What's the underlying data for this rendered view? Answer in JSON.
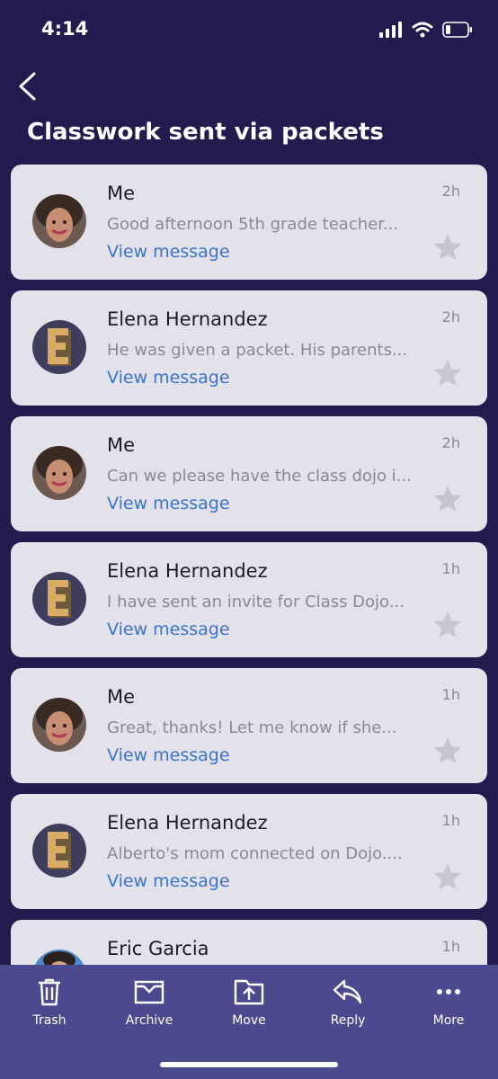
{
  "status": {
    "time": "4:14"
  },
  "header": {
    "title": "Classwork sent via packets"
  },
  "messages": [
    {
      "sender": "Me",
      "preview": "Good afternoon 5th grade teacher...",
      "link": "View message",
      "time": "2h",
      "avatar": "teacher-photo"
    },
    {
      "sender": "Elena Hernandez",
      "preview": "He was given a packet. His parents...",
      "link": "View message",
      "time": "2h",
      "avatar": "letter-e"
    },
    {
      "sender": "Me",
      "preview": "Can we please have the class dojo i...",
      "link": "View message",
      "time": "2h",
      "avatar": "teacher-photo"
    },
    {
      "sender": "Elena Hernandez",
      "preview": "I have sent an invite for Class Dojo...",
      "link": "View message",
      "time": "1h",
      "avatar": "letter-e"
    },
    {
      "sender": "Me",
      "preview": "Great, thanks! Let me know if she...",
      "link": "View message",
      "time": "1h",
      "avatar": "teacher-photo"
    },
    {
      "sender": "Elena Hernandez",
      "preview": "Alberto's mom connected on Dojo....",
      "link": "View message",
      "time": "1h",
      "avatar": "letter-e"
    },
    {
      "sender": "Eric Garcia",
      "preview": "",
      "link": "",
      "time": "1h",
      "avatar": "man-photo"
    }
  ],
  "toolbar": {
    "trash": "Trash",
    "archive": "Archive",
    "move": "Move",
    "reply": "Reply",
    "more": "More"
  },
  "colors": {
    "background": "#221b4d",
    "card": "#e3e2ea",
    "link": "#3b74c9",
    "toolbar": "#4b4a8e"
  }
}
